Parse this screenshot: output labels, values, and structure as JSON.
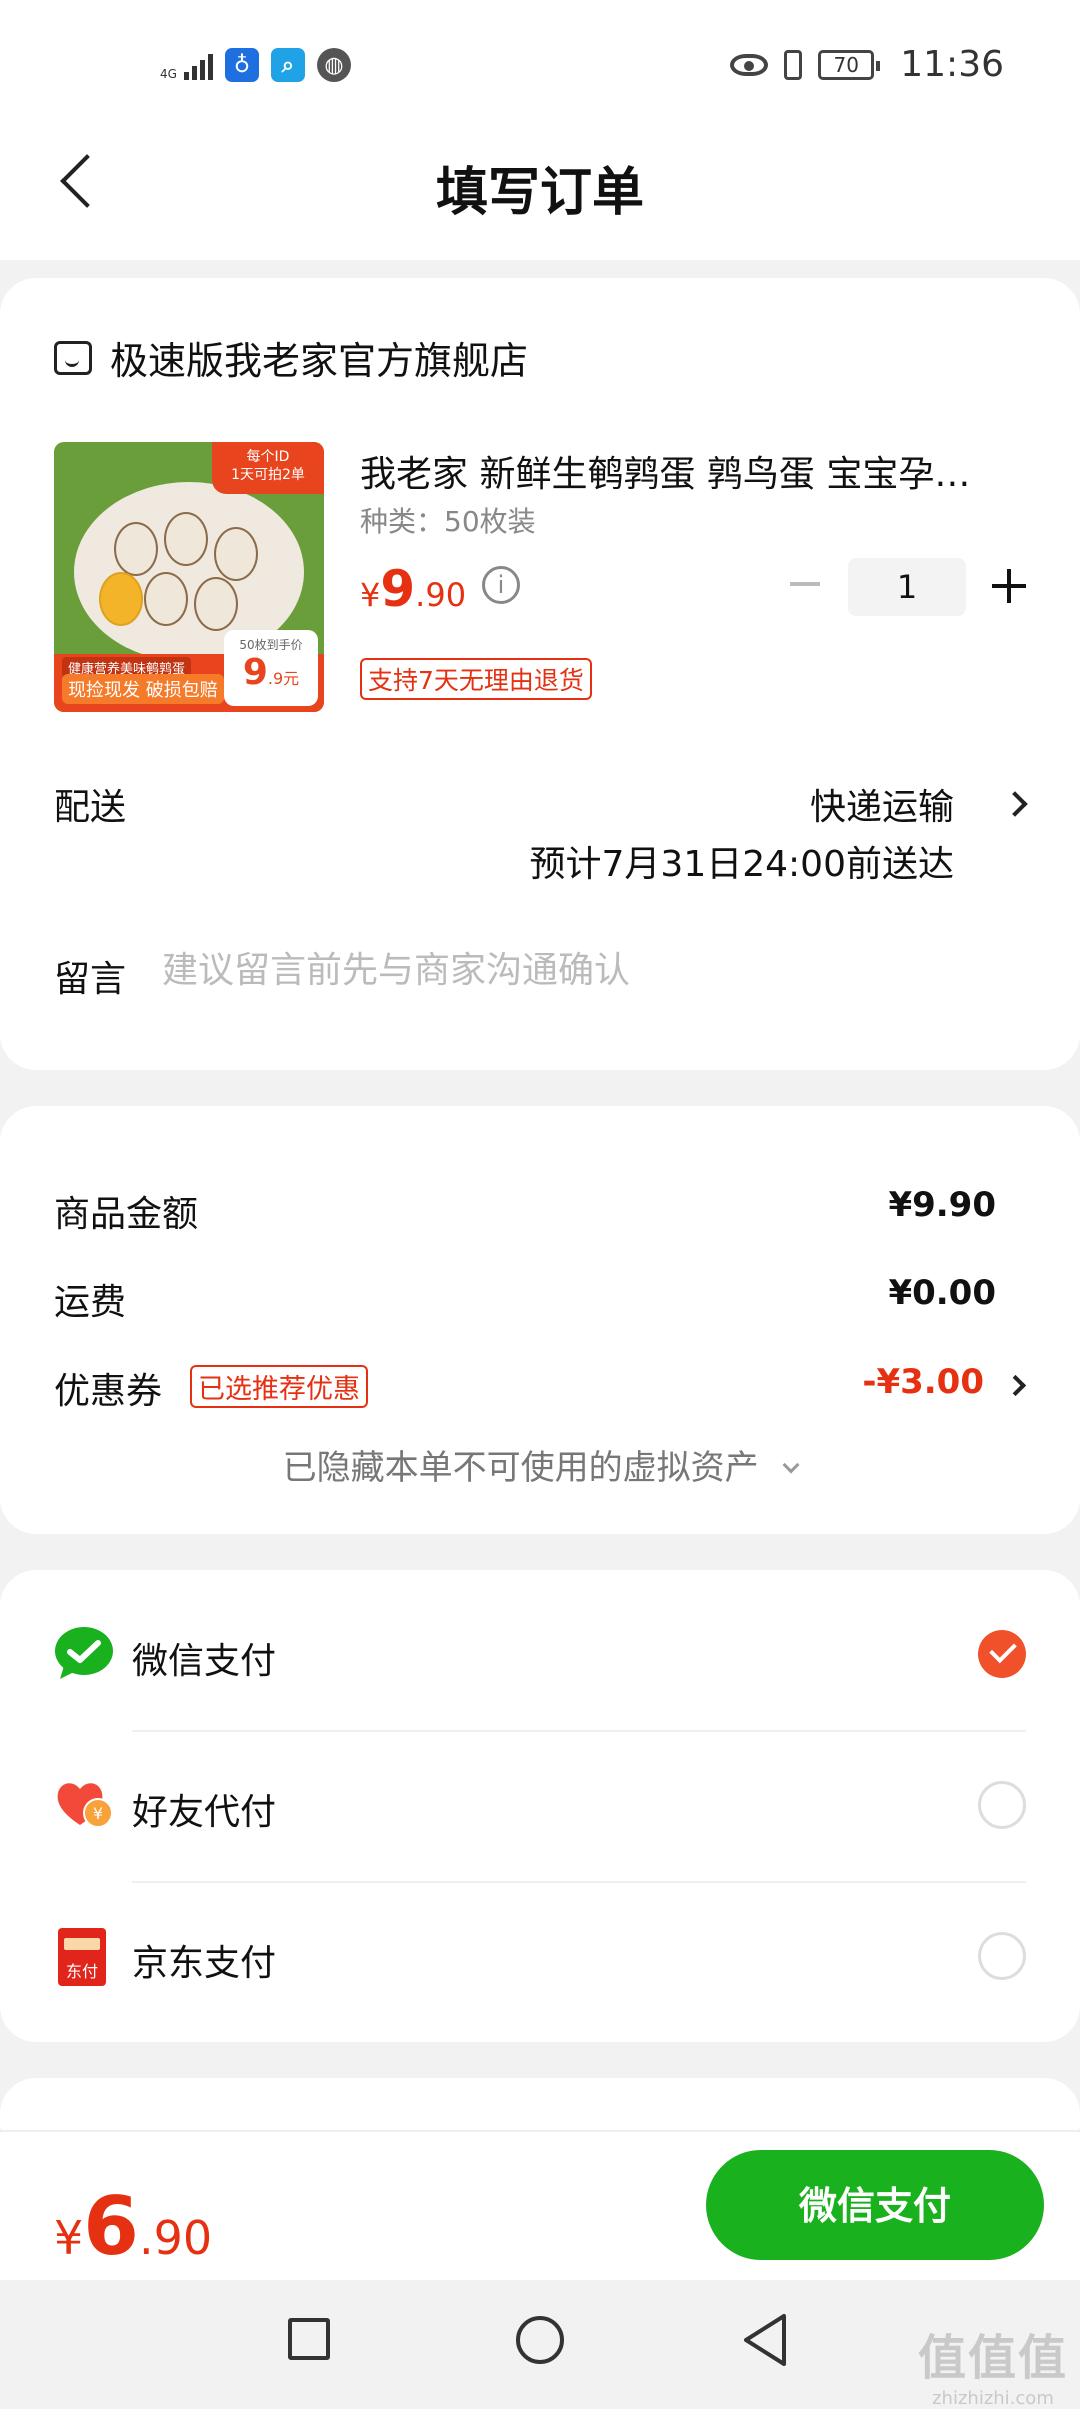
{
  "status_bar": {
    "network": "4G",
    "battery": "70",
    "time": "11:36"
  },
  "nav": {
    "title": "填写订单"
  },
  "store": {
    "name": "极速版我老家官方旗舰店"
  },
  "product": {
    "title": "我老家 新鲜生鹌鹑蛋 鹑鸟蛋 宝宝孕…",
    "spec": "种类：50枚装",
    "price_currency": "¥",
    "price_int": "9",
    "price_dec": ".90",
    "quantity": "1",
    "return_policy": "支持7天无理由退货",
    "image_texts": {
      "tag_line1": "每个ID",
      "tag_line2": "1天可拍2单",
      "bar_line1": "健康营养美味鹌鹑蛋",
      "bar_line2": "现捡现发 破损包赔",
      "pill_top": "50枚到手价",
      "pill_price": "9",
      "pill_dec": ".9元"
    }
  },
  "delivery": {
    "label": "配送",
    "method": "快递运输",
    "eta": "预计7月31日24:00前送达"
  },
  "message": {
    "label": "留言",
    "placeholder": "建议留言前先与商家沟通确认"
  },
  "summary": {
    "goods_label": "商品金额",
    "goods_amount": "¥9.90",
    "shipping_label": "运费",
    "shipping_amount": "¥0.00",
    "coupon_label": "优惠券",
    "coupon_tag": "已选推荐优惠",
    "coupon_amount": "-¥3.00",
    "hidden_assets": "已隐藏本单不可使用的虚拟资产"
  },
  "payment": {
    "options": [
      {
        "label": "微信支付",
        "icon": "wechat-pay-icon",
        "selected": true
      },
      {
        "label": "好友代付",
        "icon": "friend-pay-icon",
        "selected": false
      },
      {
        "label": "京东支付",
        "icon": "jd-pay-icon",
        "selected": false
      }
    ],
    "jd_icon_text": "东付"
  },
  "footer": {
    "total_currency": "¥",
    "total_int": "6",
    "total_dec": ".90",
    "pay_button": "微信支付"
  },
  "watermark": {
    "line1": "值值值",
    "line2": "zhizhizhi.com"
  },
  "colors": {
    "accent_red": "#e53112",
    "pay_green": "#1ab11f",
    "check_orange": "#f0502a"
  }
}
